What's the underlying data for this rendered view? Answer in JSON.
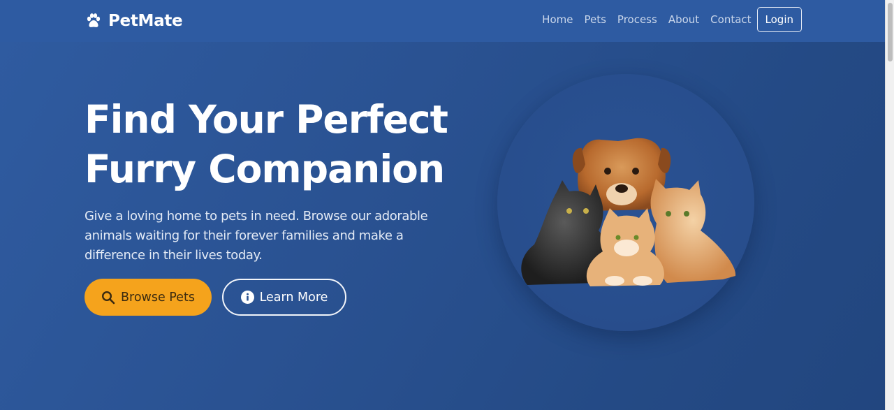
{
  "brand": {
    "name": "PetMate",
    "icon": "paw-icon"
  },
  "nav": {
    "links": [
      "Home",
      "Pets",
      "Process",
      "About",
      "Contact"
    ],
    "login_label": "Login"
  },
  "hero": {
    "title_line1": "Find Your Perfect",
    "title_line2": "Furry Companion",
    "subtitle": "Give a loving home to pets in need. Browse our adorable animals waiting for their forever families and make a difference in their lives today.",
    "browse_label": "Browse Pets",
    "browse_icon": "search-icon",
    "learn_label": "Learn More",
    "learn_icon": "info-circle-icon",
    "image": "dog-and-cats-illustration"
  },
  "colors": {
    "navbar": "#2e5ba2",
    "hero": "#2a5292",
    "accent": "#f5a31c",
    "text": "#ffffff"
  }
}
